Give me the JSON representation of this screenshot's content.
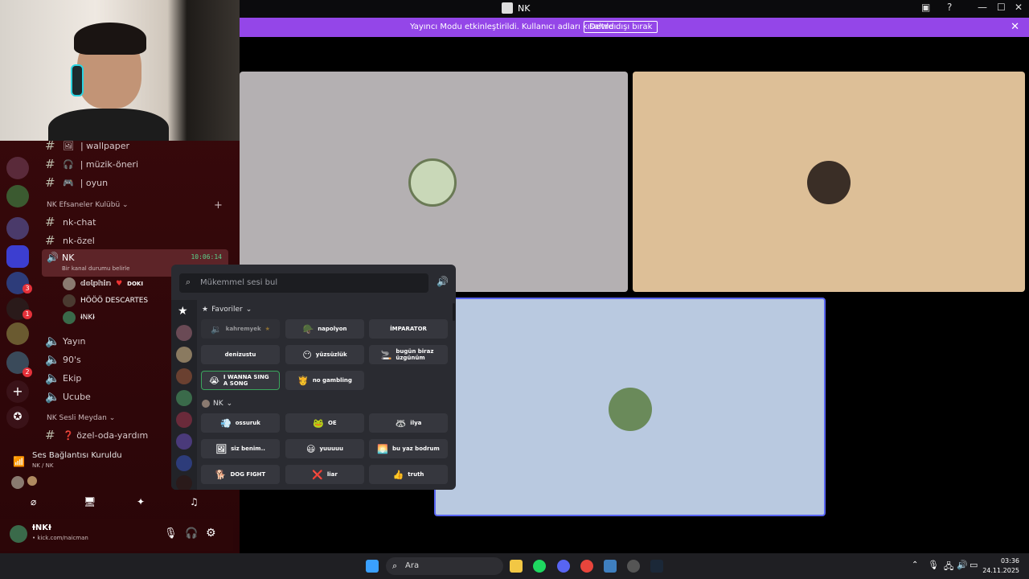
{
  "window": {
    "title": "NK"
  },
  "banner": {
    "text": "Yayıncı Modu etkinleştirildi. Kullanıcı adları kısaltıldı.",
    "button": "Devre dışı bırak",
    "color": "#9446e8"
  },
  "channels": {
    "top": [
      {
        "label": "| wallpaper",
        "emoji": "🖼"
      },
      {
        "label": "| müzik-öneri",
        "emoji": "🎧"
      },
      {
        "label": "| oyun",
        "emoji": "🎮"
      }
    ],
    "category1": "NK Efsaneler Kulübü",
    "text": [
      "nk-chat",
      "nk-özel"
    ],
    "active_voice": {
      "name": "NK",
      "status": "Bir kanal durumu belirle",
      "timer": "10:06:14"
    },
    "voice_users": [
      "𝕕𝕠𝕝𝕡𝕙𝕚𝕟",
      "DOKI",
      "HÖÖÖ DESCARTES",
      "ƗNKƗ"
    ],
    "voice_channels": [
      "Yayın",
      "90's",
      "Ekip",
      "Ucube"
    ],
    "category2": "NK Sesli Meydan",
    "last": "❓ özel-oda-yardım"
  },
  "server_badges": [
    "3",
    "1",
    "2"
  ],
  "voice": {
    "status": "Ses Bağlantısı Kuruldu",
    "sub": "NK / NK"
  },
  "user": {
    "name": "ƗNKƗ",
    "sub": "• kick.com/naicman"
  },
  "soundboard": {
    "placeholder": "Mükemmel sesi bul",
    "favorites_label": "Favoriler",
    "favorites": [
      {
        "label": "kahremyek",
        "emoji": "🔉"
      },
      {
        "label": "napolyon",
        "emoji": "🪖"
      },
      {
        "label": "İMPARATOR",
        "emoji": ""
      },
      {
        "label": "denizustu",
        "emoji": ""
      },
      {
        "label": "yüzsüzlük",
        "emoji": "😶"
      },
      {
        "label": "bugün biraz üzgünüm",
        "emoji": "🚬"
      },
      {
        "label": "I WANNA SING A SONG",
        "emoji": "😭"
      },
      {
        "label": "no gambling",
        "emoji": "🫅"
      }
    ],
    "nk_label": "NK",
    "nk": [
      {
        "label": "ossuruk",
        "emoji": "💨"
      },
      {
        "label": "OE",
        "emoji": "🐸"
      },
      {
        "label": "ilya",
        "emoji": "🦝"
      },
      {
        "label": "siz benim..",
        "emoji": "🖼"
      },
      {
        "label": "yuuuuu",
        "emoji": "😃"
      },
      {
        "label": "bu yaz bodrum",
        "emoji": "🌅"
      },
      {
        "label": "DOG FIGHT",
        "emoji": "🐕"
      },
      {
        "label": "liar",
        "emoji": "❌"
      },
      {
        "label": "truth",
        "emoji": "👍"
      }
    ]
  },
  "taskbar": {
    "search": "Ara",
    "time": "03:36",
    "date": "24.11.2025"
  }
}
